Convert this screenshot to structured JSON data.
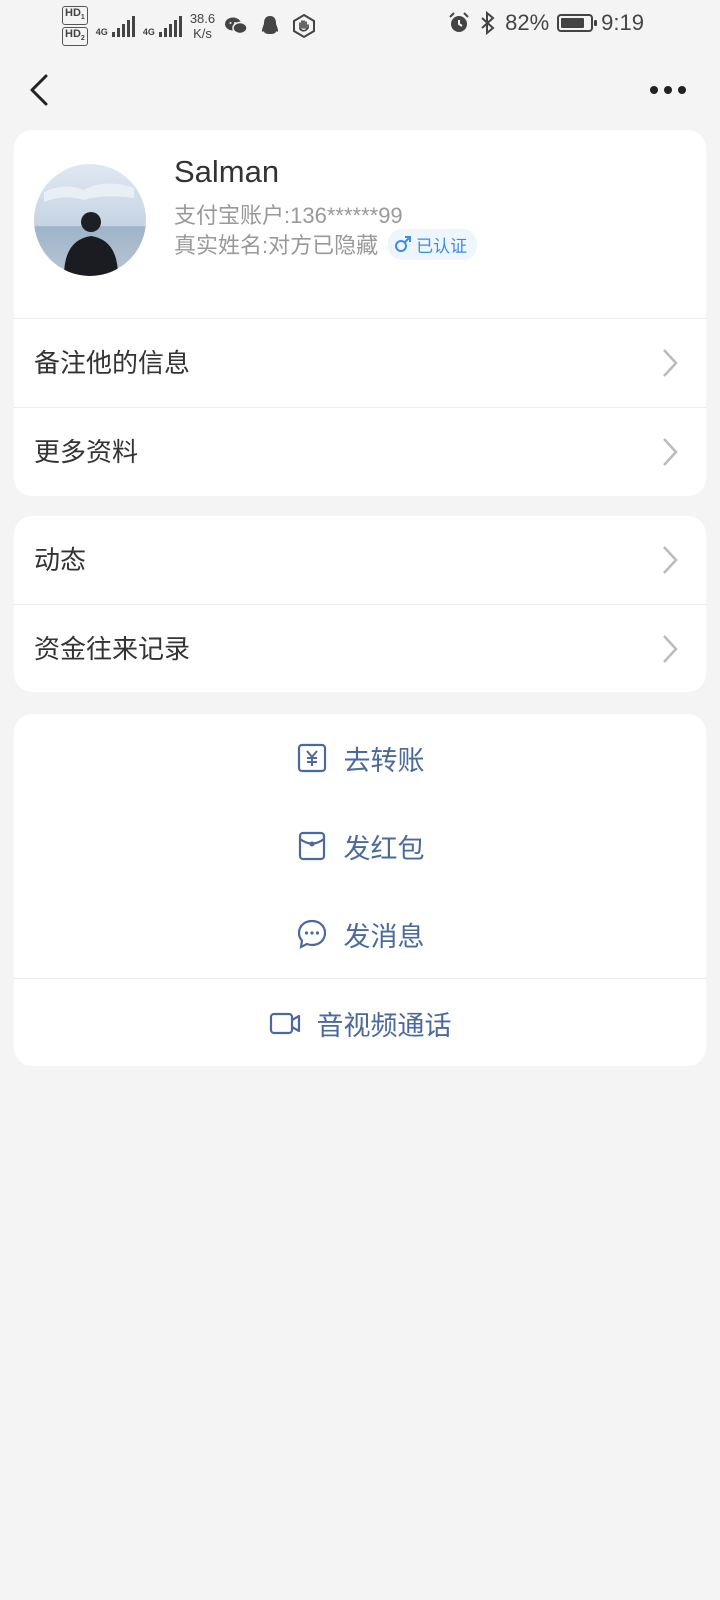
{
  "status_bar": {
    "hd1": "HD",
    "hd1_sub": "1",
    "hd2": "HD",
    "hd2_sub": "2",
    "net1": "4G",
    "net2": "4G",
    "speed_value": "38.6",
    "speed_unit": "K/s",
    "battery_percent": "82%",
    "battery_level": 0.82,
    "time": "9:19",
    "icons": [
      "wechat-icon",
      "qq-icon",
      "hand-shield-icon",
      "alarm-icon",
      "bluetooth-icon",
      "battery-icon"
    ]
  },
  "navbar": {
    "back_icon": "chevron-left-icon",
    "more_icon": "more-dots-icon"
  },
  "profile": {
    "name": "Salman",
    "account": "支付宝账户:136******99",
    "real_name": "真实姓名:对方已隐藏",
    "verified_label": "已认证",
    "gender_icon": "male-icon"
  },
  "info_menu": {
    "items": [
      {
        "label": "备注他的信息"
      },
      {
        "label": "更多资料"
      }
    ]
  },
  "activity_menu": {
    "items": [
      {
        "label": "动态"
      },
      {
        "label": "资金往来记录"
      }
    ]
  },
  "actions": {
    "transfer_label": "去转账",
    "red_packet_label": "发红包",
    "message_label": "发消息",
    "call_label": "音视频通话"
  },
  "colors": {
    "accent_blue": "#3a8de3",
    "action_text": "#4b6a9b",
    "background": "#f4f4f4"
  }
}
